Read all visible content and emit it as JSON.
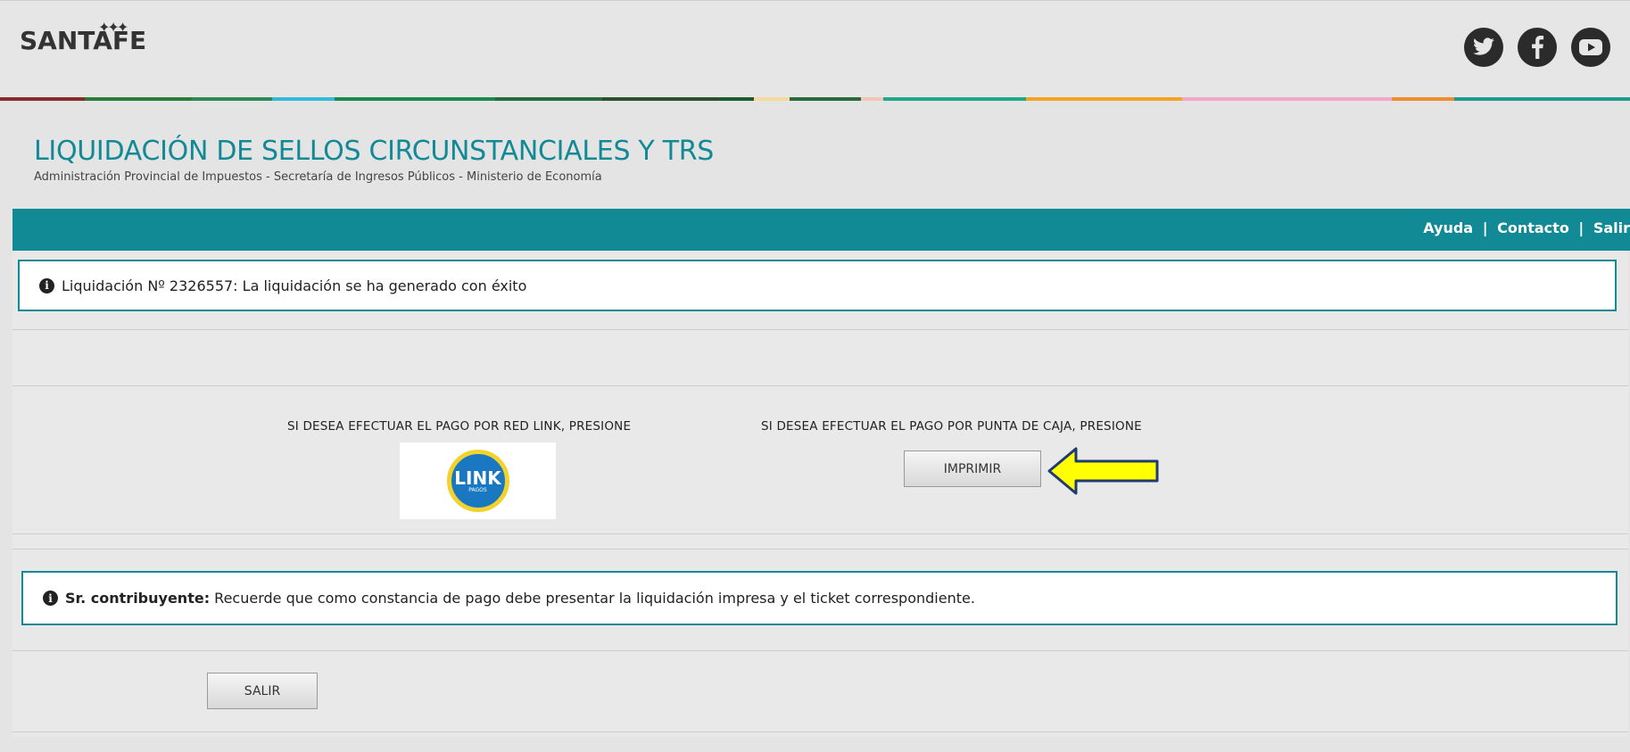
{
  "header": {
    "logo_text": "SANTAFE",
    "social_icons": [
      "twitter-icon",
      "facebook-icon",
      "youtube-icon"
    ]
  },
  "page": {
    "title": "LIQUIDACIÓN DE SELLOS CIRCUNSTANCIALES Y TRS",
    "subtitle": "Administración Provincial de Impuestos - Secretaría de Ingresos Públicos - Ministerio de Economía"
  },
  "nav": {
    "help": "Ayuda",
    "contact": "Contacto",
    "exit": "Salir"
  },
  "success_message": {
    "icon": "info-icon",
    "text": "Liquidación Nº 2326557: La liquidación se ha generado con éxito"
  },
  "payment": {
    "link_label": "SI DESEA EFECTUAR EL PAGO POR RED LINK, PRESIONE",
    "link_logo_text": "LINK",
    "link_logo_subtext": "PAGOS",
    "cash_label": "SI DESEA EFECTUAR EL PAGO POR PUNTA DE CAJA, PRESIONE",
    "print_button": "IMPRIMIR"
  },
  "notice": {
    "icon": "info-icon",
    "bold": "Sr. contribuyente:",
    "text": " Recuerde que como constancia de pago debe presentar la liquidación impresa y el ticket correspondiente."
  },
  "exit_button": "SALIR",
  "colors": {
    "brand_teal": "#128a96",
    "arrow_fill": "#ffff00",
    "arrow_stroke": "#1f3b70"
  }
}
